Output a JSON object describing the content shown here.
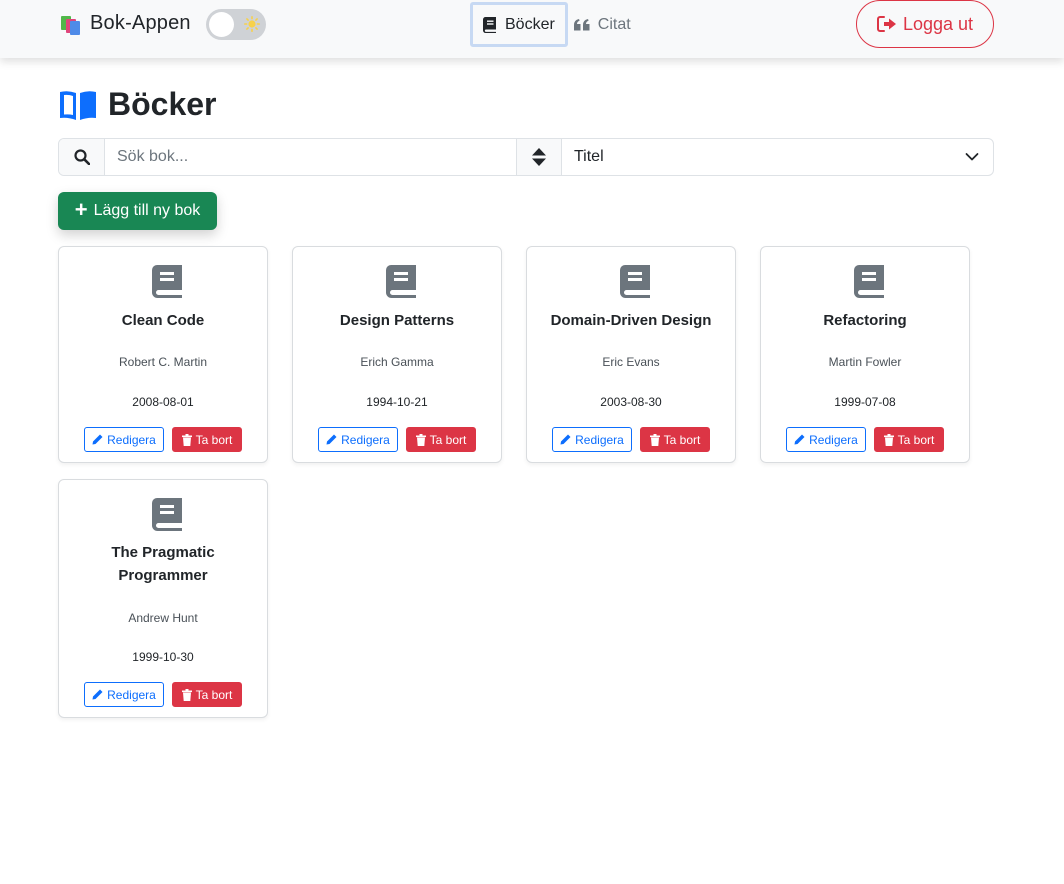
{
  "app": {
    "name": "Bok-Appen",
    "theme_toggle_icon": "sun-icon"
  },
  "nav": {
    "tabs": [
      {
        "label": "Böcker",
        "icon": "book-icon",
        "active": true
      },
      {
        "label": "Citat",
        "icon": "quote-icon",
        "active": false
      }
    ],
    "logout_label": "Logga ut"
  },
  "page": {
    "title": "Böcker",
    "title_icon": "open-book-icon"
  },
  "search": {
    "placeholder": "Sök bok...",
    "value": "",
    "sort_selected": "Titel"
  },
  "add_button_label": "Lägg till ny bok",
  "books": [
    {
      "title": "Clean Code",
      "author": "Robert C. Martin",
      "date": "2008-08-01"
    },
    {
      "title": "Design Patterns",
      "author": "Erich Gamma",
      "date": "1994-10-21"
    },
    {
      "title": "Domain-Driven Design",
      "author": "Eric Evans",
      "date": "2003-08-30"
    },
    {
      "title": "Refactoring",
      "author": "Martin Fowler",
      "date": "1999-07-08"
    },
    {
      "title": "The Pragmatic Programmer",
      "author": "Andrew Hunt",
      "date": "1999-10-30"
    }
  ],
  "card_actions": {
    "edit_label": "Redigera",
    "delete_label": "Ta bort"
  },
  "colors": {
    "primary": "#0d6efd",
    "success": "#198754",
    "danger": "#dc3545",
    "icon_gray": "#6c757d"
  }
}
